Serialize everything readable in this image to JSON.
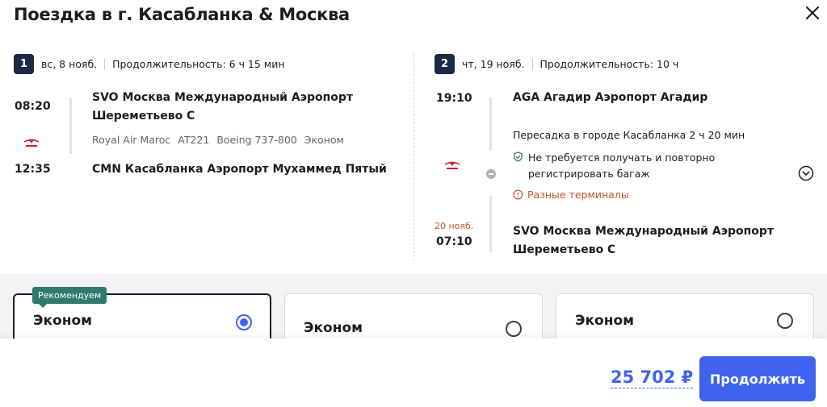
{
  "header": {
    "title": "Поездка в г. Касабланка & Москва"
  },
  "segment1": {
    "number": "1",
    "date": "вс, 8 нояб.",
    "duration": "Продолжительность: 6 ч 15 мин",
    "dep_time": "08:20",
    "arr_time": "12:35",
    "dep_airport_line1": "SVO Москва Международный Аэропорт",
    "dep_airport_line2": "Шереметьево С",
    "airline": "Royal Air Maroc",
    "flight": "AT221",
    "aircraft": "Boeing 737-800",
    "cabin": "Эконом",
    "arr_airport": "CMN Касабланка Аэропорт Мухаммед Пятый"
  },
  "segment2": {
    "number": "2",
    "date": "чт, 19 нояб.",
    "duration": "Продолжительность: 10 ч",
    "dep_time": "19:10",
    "dep_airport": "AGA Агадир Аэропорт Агадир",
    "transfer": "Пересадка в городе Касабланка  2 ч 20 мин",
    "baggage_line1": "Не требуется получать и повторно",
    "baggage_line2": "регистрировать багаж",
    "terminals_warning": "Разные терминалы",
    "arr_date": "20 нояб.",
    "arr_time": "07:10",
    "arr_airport_line1": "SVO Москва Международный Аэропорт",
    "arr_airport_line2": "Шереметьево С"
  },
  "fares": {
    "badge": "Рекомендуем",
    "items": [
      {
        "name": "Эконом",
        "selected": true
      },
      {
        "name": "Эконом",
        "selected": false
      },
      {
        "name": "Эконом",
        "selected": false
      }
    ]
  },
  "footer": {
    "price": "25 702 ₽",
    "continue_label": "Продолжить"
  },
  "colors": {
    "accent": "#3f63f0",
    "badge": "#2f7a6f",
    "warning": "#c0562b",
    "segment_badge": "#1b2a44"
  }
}
